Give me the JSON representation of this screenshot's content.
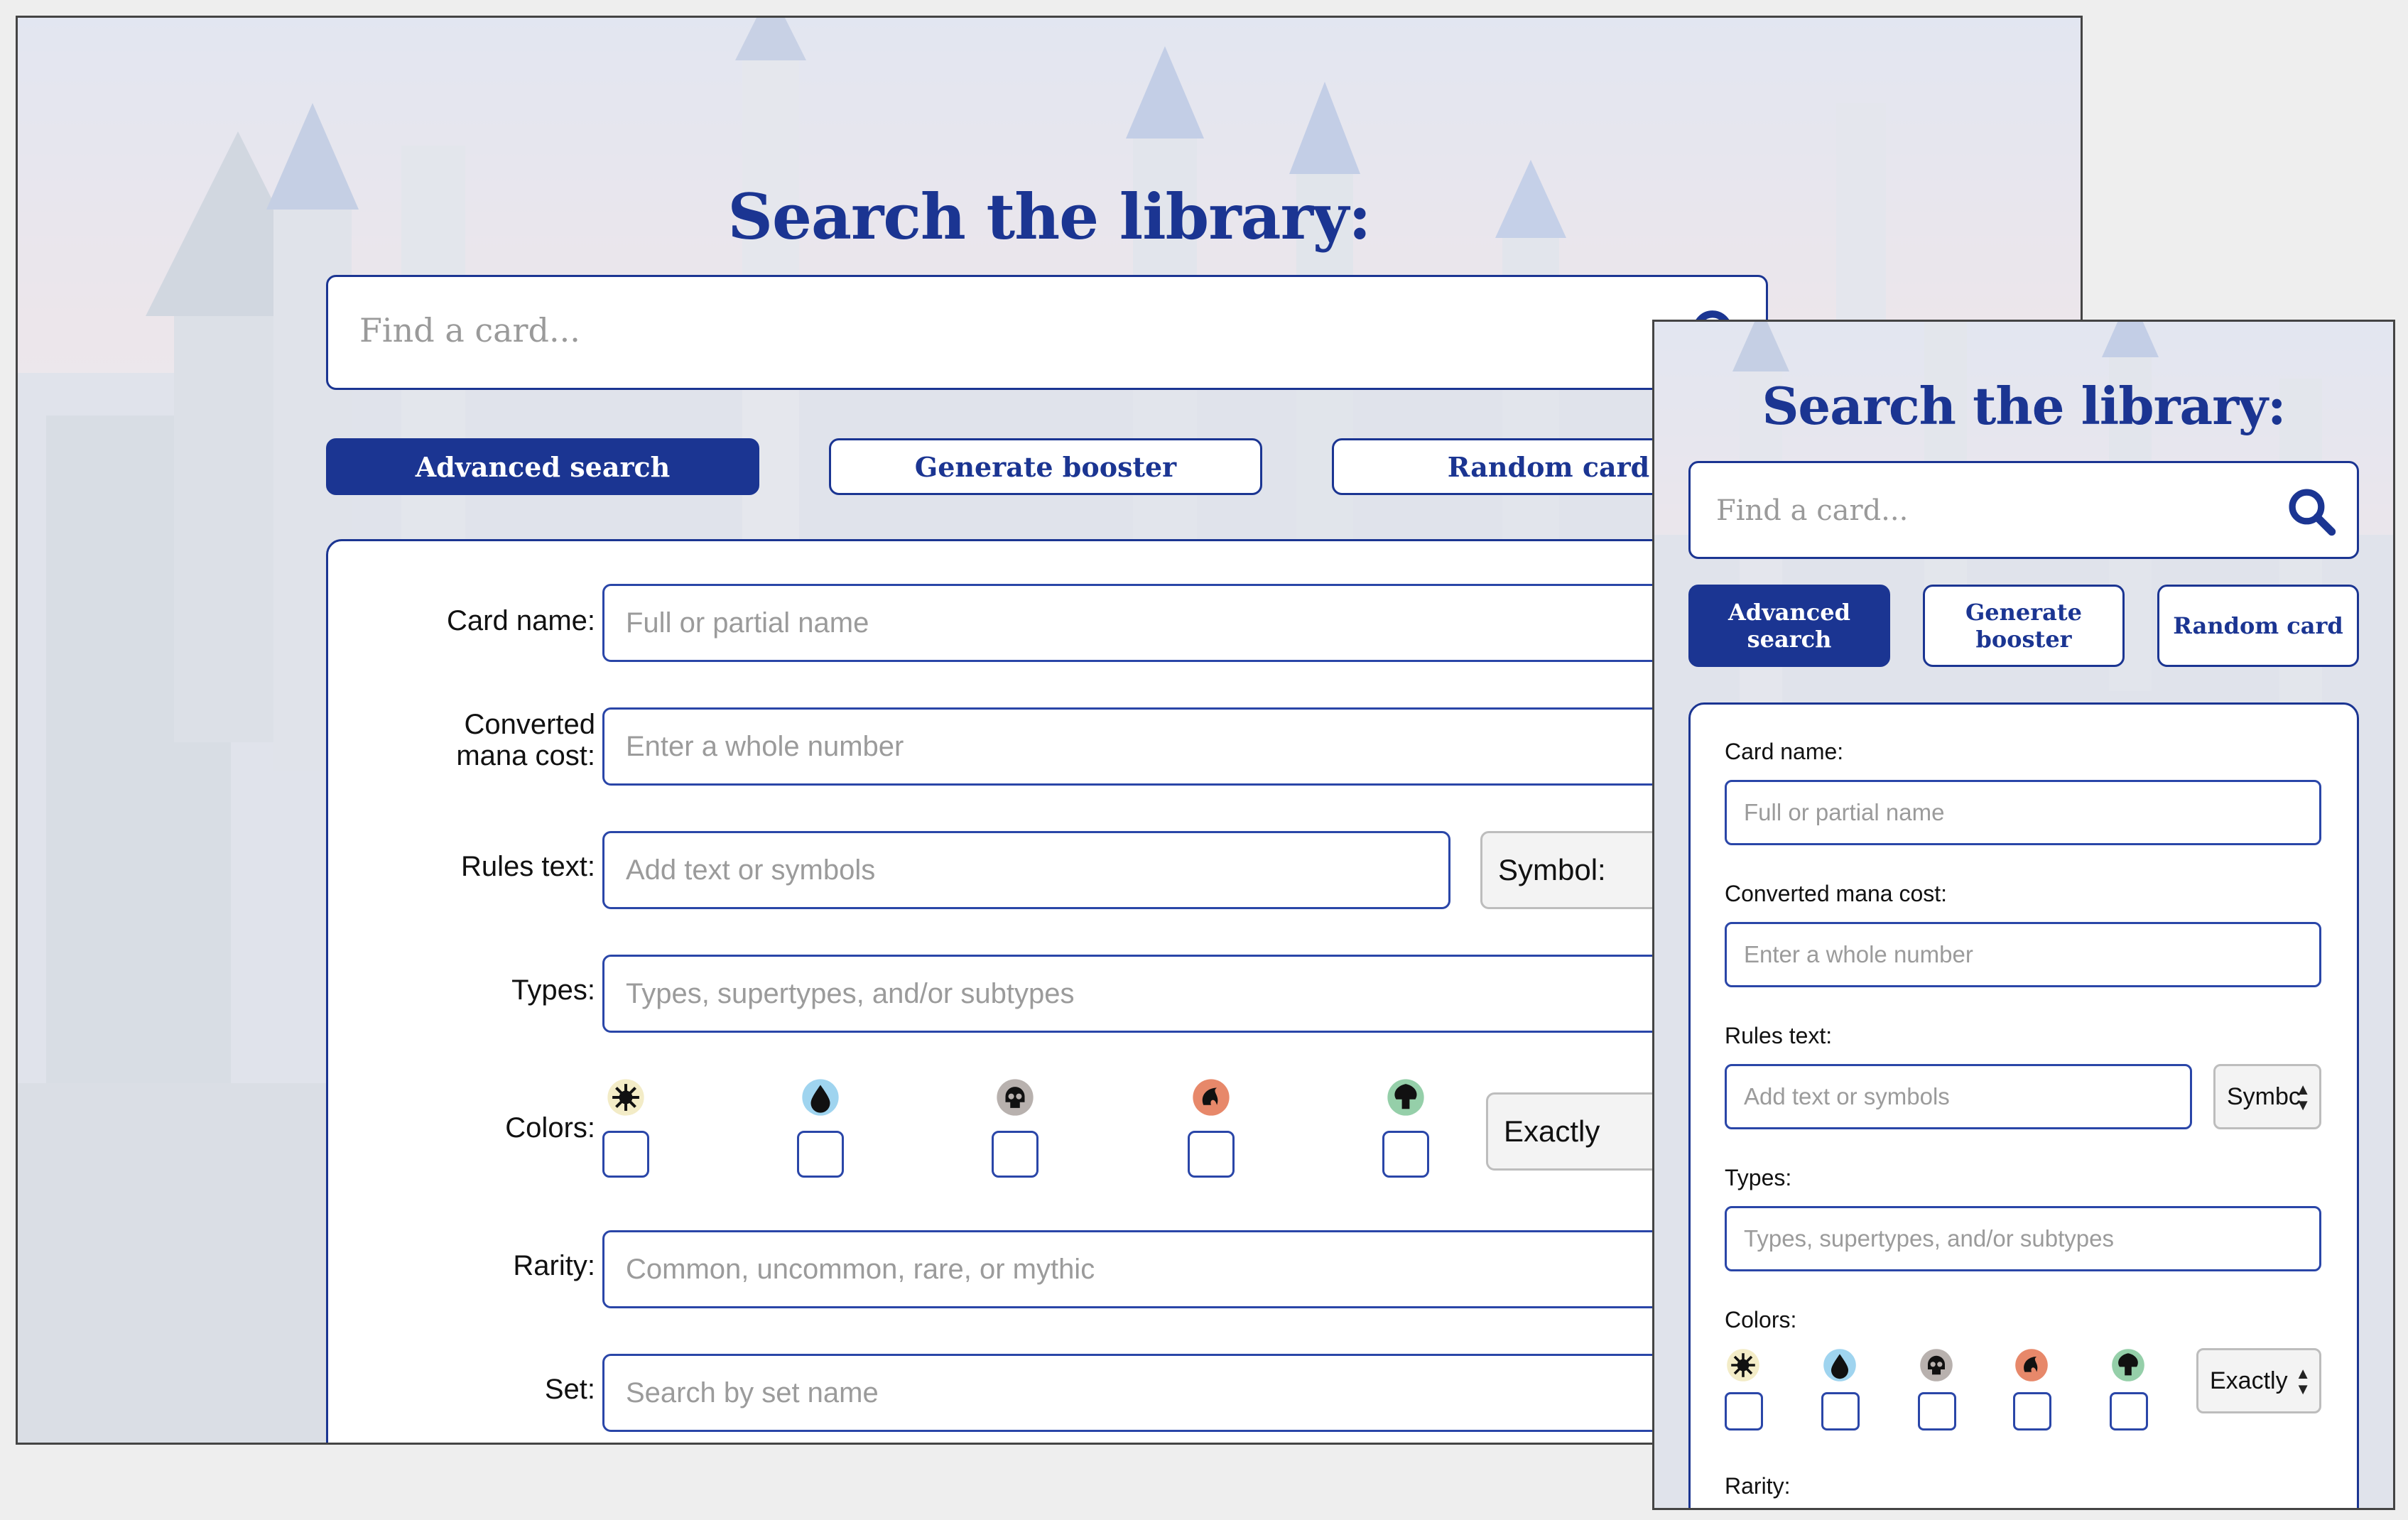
{
  "heading": "Search the library:",
  "search": {
    "placeholder": "Find a card..."
  },
  "buttons": {
    "advanced": "Advanced search",
    "booster": "Generate booster",
    "random": "Random card"
  },
  "form": {
    "card_name": {
      "label": "Card name:",
      "placeholder": "Full or partial name"
    },
    "cmc": {
      "label": "Converted mana cost:",
      "label_line1": "Converted",
      "label_line2": "mana cost:",
      "placeholder": "Enter a whole number"
    },
    "rules": {
      "label": "Rules text:",
      "placeholder": "Add text or symbols",
      "symbol_select": "Symbol:",
      "symbol_select_mobile": "Symbc"
    },
    "types": {
      "label": "Types:",
      "placeholder": "Types, supertypes, and/or subtypes"
    },
    "colors": {
      "label": "Colors:",
      "match_select": "Exactly",
      "items": [
        "white-mana-icon",
        "blue-mana-icon",
        "black-mana-icon",
        "red-mana-icon",
        "green-mana-icon"
      ]
    },
    "rarity": {
      "label": "Rarity:",
      "placeholder": "Common, uncommon, rare, or mythic"
    },
    "set": {
      "label": "Set:",
      "placeholder": "Search by set name"
    }
  },
  "colors": {
    "brand": "#1b3592",
    "white_mana": "#f3ecc7",
    "blue_mana": "#9fd4ef",
    "black_mana": "#b8b1ae",
    "red_mana": "#e7886a",
    "green_mana": "#95cfa9"
  }
}
